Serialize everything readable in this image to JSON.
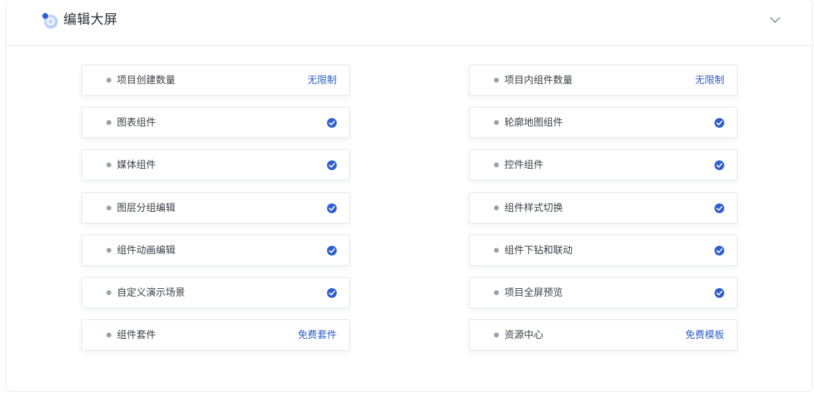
{
  "header": {
    "title": "编辑大屏"
  },
  "features": {
    "left": [
      {
        "label": "项目创建数量",
        "value": "无限制"
      },
      {
        "label": "图表组件",
        "value": ""
      },
      {
        "label": "媒体组件",
        "value": ""
      },
      {
        "label": "图层分组编辑",
        "value": ""
      },
      {
        "label": "组件动画编辑",
        "value": ""
      },
      {
        "label": "自定义演示场景",
        "value": ""
      },
      {
        "label": "组件套件",
        "value": "免费套件"
      }
    ],
    "right": [
      {
        "label": "项目内组件数量",
        "value": "无限制"
      },
      {
        "label": "轮廓地图组件",
        "value": ""
      },
      {
        "label": "控件组件",
        "value": ""
      },
      {
        "label": "组件样式切换",
        "value": ""
      },
      {
        "label": "组件下钻和联动",
        "value": ""
      },
      {
        "label": "项目全屏预览",
        "value": ""
      },
      {
        "label": "资源中心",
        "value": "免费模板"
      }
    ]
  },
  "colors": {
    "accent": "#2d5fc8",
    "check": "#2f5fd0",
    "border": "#e3e6ec"
  },
  "icons": {
    "logo": "app-logo-icon",
    "collapse": "chevron-down-icon",
    "included": "check-circle-icon"
  }
}
